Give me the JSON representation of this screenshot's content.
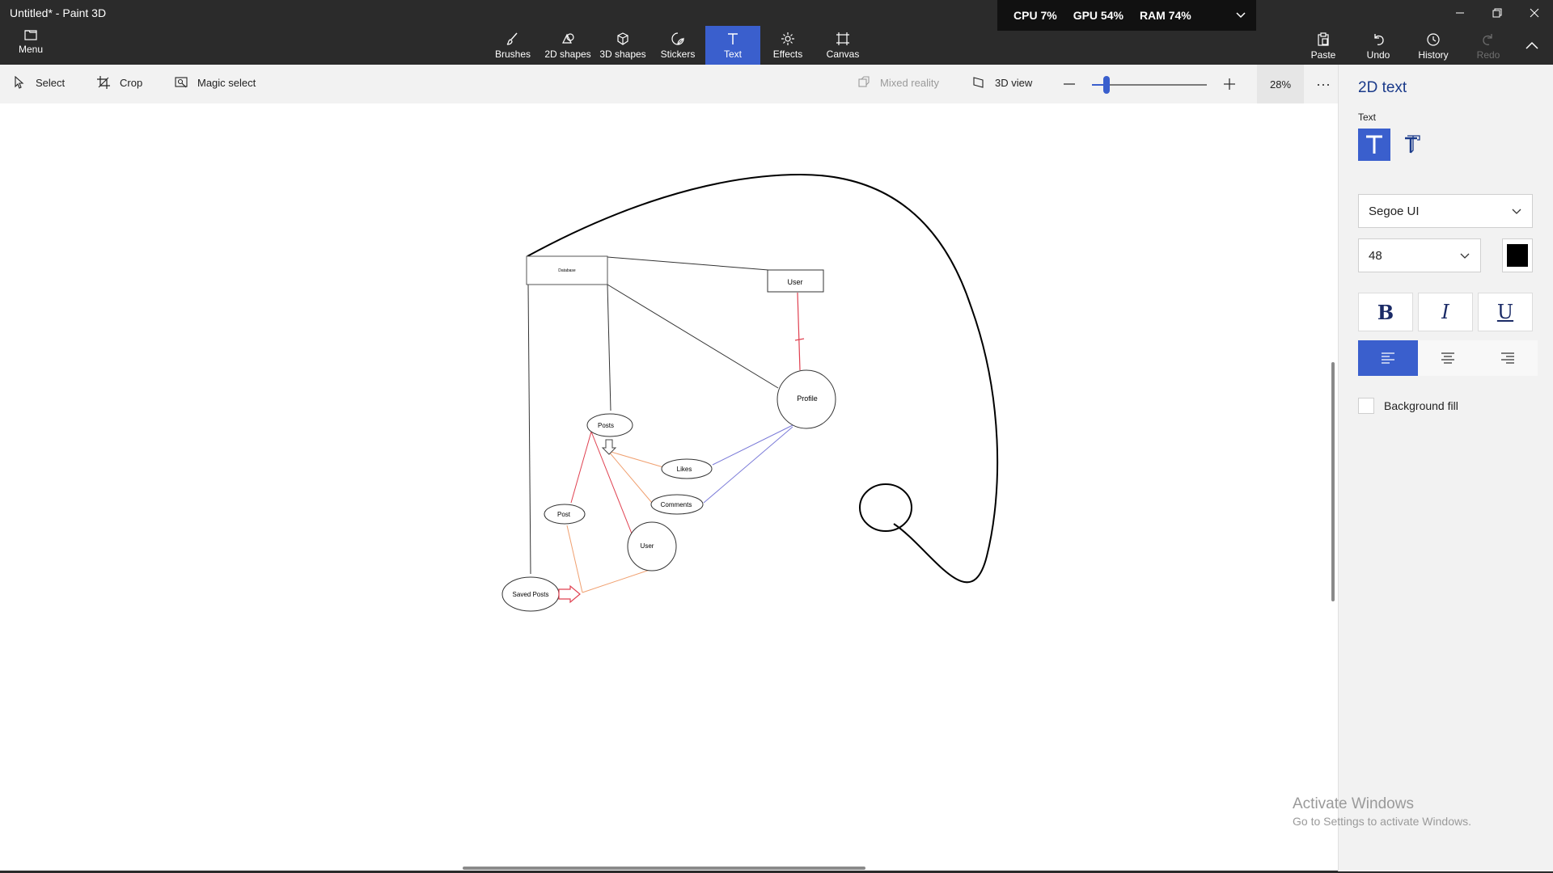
{
  "window": {
    "title": "Untitled* - Paint 3D"
  },
  "menu": {
    "label": "Menu"
  },
  "tools": [
    {
      "label": "Brushes",
      "icon": "brush-icon"
    },
    {
      "label": "2D shapes",
      "icon": "2d-shapes-icon"
    },
    {
      "label": "3D shapes",
      "icon": "3d-shapes-icon"
    },
    {
      "label": "Stickers",
      "icon": "stickers-icon"
    },
    {
      "label": "Text",
      "icon": "text-icon",
      "active": true
    },
    {
      "label": "Effects",
      "icon": "effects-icon"
    },
    {
      "label": "Canvas",
      "icon": "canvas-icon"
    }
  ],
  "right_tools": {
    "paste": "Paste",
    "undo": "Undo",
    "history": "History",
    "redo": "Redo"
  },
  "perf": {
    "cpu": "CPU  7%",
    "gpu": "GPU  54%",
    "ram": "RAM  74%"
  },
  "subbar": {
    "select": "Select",
    "crop": "Crop",
    "magic_select": "Magic select",
    "mixed_reality": "Mixed reality",
    "view_3d": "3D view",
    "zoom": "28%",
    "zoom_fraction": 0.28,
    "more": "···"
  },
  "diagram": {
    "database": "Database",
    "user_top": "User",
    "profile": "Profile",
    "posts": "Posts",
    "likes": "Likes",
    "comments": "Comments",
    "post": "Post",
    "user": "User",
    "saved_posts": "Saved Posts"
  },
  "panel": {
    "title": "2D text",
    "text_label": "Text",
    "font": "Segoe UI",
    "size": "48",
    "color": "#000000",
    "bold": "B",
    "italic": "I",
    "underline": "U",
    "background_fill": "Background fill"
  },
  "watermark": {
    "title": "Activate Windows",
    "subtitle": "Go to Settings to activate Windows."
  },
  "colors": {
    "accent": "#3a5fcd",
    "toolbar": "#2b2b2b",
    "red_line": "#e04050",
    "orange_line": "#f0a070",
    "blue_line": "#7a7ad8"
  }
}
